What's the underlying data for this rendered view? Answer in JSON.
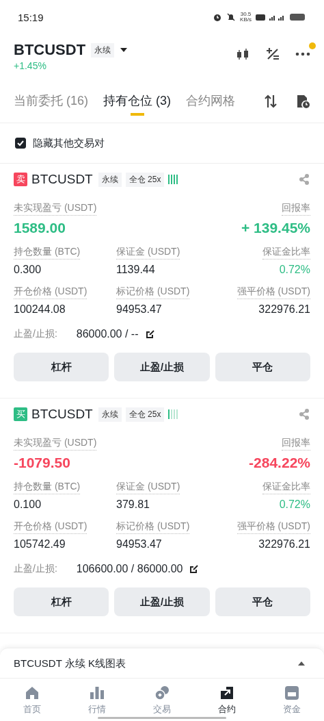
{
  "status_bar": {
    "time": "15:19",
    "speed": "30.5",
    "speed_unit": "KB/s"
  },
  "header": {
    "symbol": "BTCUSDT",
    "contract": "永续",
    "change": "+1.45%",
    "notification": true
  },
  "tabs": [
    {
      "label": "当前委托 (16)",
      "selected": false
    },
    {
      "label": "持有仓位 (3)",
      "selected": true
    },
    {
      "label": "合约网格",
      "selected": false
    }
  ],
  "hide_other_pairs": {
    "label": "隐藏其他交易对",
    "checked": true
  },
  "positions": [
    {
      "kind": "sell",
      "side_label": "卖",
      "symbol": "BTCUSDT",
      "contract": "永续",
      "margin_mode": "全仓 25x",
      "pnl_label": "未实现盈亏 (USDT)",
      "pnl": "1589.00",
      "roe_label": "回报率",
      "roe": "+ 139.45%",
      "loss": false,
      "fields": [
        {
          "label": "持仓数量 (BTC)",
          "value": "0.300",
          "kind": "amount"
        },
        {
          "label": "保证金 (USDT)",
          "value": "1139.44",
          "kind": "amount"
        },
        {
          "label": "保证金比率",
          "value": "0.72%",
          "kind": "ratio"
        },
        {
          "label": "开仓价格 (USDT)",
          "value": "100244.08",
          "kind": "amount"
        },
        {
          "label": "标记价格 (USDT)",
          "value": "94953.47",
          "kind": "amount"
        },
        {
          "label": "强平价格 (USDT)",
          "value": "322976.21",
          "kind": "amount"
        }
      ],
      "tpsl_label": "止盈/止损:",
      "tpsl": "86000.00 / --",
      "buttons": [
        "杠杆",
        "止盈/止损",
        "平仓"
      ]
    },
    {
      "kind": "buy",
      "side_label": "买",
      "symbol": "BTCUSDT",
      "contract": "永续",
      "margin_mode": "全仓 25x",
      "pnl_label": "未实现盈亏 (USDT)",
      "pnl": "-1079.50",
      "roe_label": "回报率",
      "roe": "-284.22%",
      "loss": true,
      "fields": [
        {
          "label": "持仓数量 (BTC)",
          "value": "0.100",
          "kind": "amount"
        },
        {
          "label": "保证金 (USDT)",
          "value": "379.81",
          "kind": "amount"
        },
        {
          "label": "保证金比率",
          "value": "0.72%",
          "kind": "ratio"
        },
        {
          "label": "开仓价格 (USDT)",
          "value": "105742.49",
          "kind": "amount"
        },
        {
          "label": "标记价格 (USDT)",
          "value": "94953.47",
          "kind": "amount"
        },
        {
          "label": "强平价格 (USDT)",
          "value": "322976.21",
          "kind": "amount"
        }
      ],
      "tpsl_label": "止盈/止损:",
      "tpsl": "106600.00 / 86000.00",
      "buttons": [
        "杠杆",
        "止盈/止损",
        "平仓"
      ]
    }
  ],
  "chart_bar": {
    "label": "BTCUSDT 永续 K线图表"
  },
  "nav": [
    {
      "label": "首页",
      "kind": "home",
      "selected": false
    },
    {
      "label": "行情",
      "kind": "markets",
      "selected": false
    },
    {
      "label": "交易",
      "kind": "trade",
      "selected": false
    },
    {
      "label": "合约",
      "kind": "futures",
      "selected": true
    },
    {
      "label": "资金",
      "kind": "wallet",
      "selected": false
    }
  ]
}
